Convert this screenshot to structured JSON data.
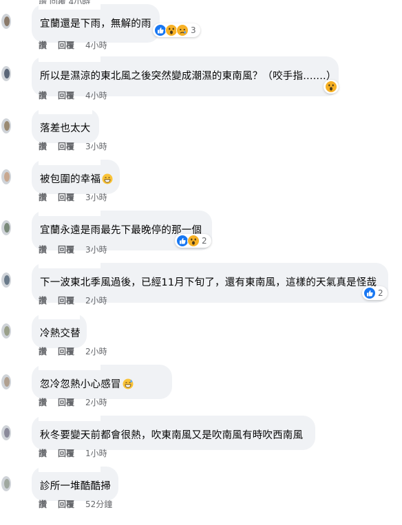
{
  "colors": {
    "bubble": "#f0f2f5",
    "meta": "#65676b",
    "text": "#050505",
    "like_blue": "#1877f2",
    "haha_yellow": "#f7b125"
  },
  "action_labels": {
    "like": "讚",
    "reply": "回覆"
  },
  "top_partial": {
    "text": "讚   回覆   4小時"
  },
  "comments": [
    {
      "text": "宜蘭還是下雨，無解的雨",
      "time": "4小時",
      "reactions": {
        "icons": [
          "like-icon",
          "wow-icon",
          "sad-icon"
        ],
        "count": "3"
      }
    },
    {
      "text": "所以是濕涼的東北風之後突然變成潮濕的東南風？（咬手指.......）",
      "time": "4小時",
      "reactions": {
        "icons": [
          "wow-icon"
        ],
        "count": ""
      }
    },
    {
      "text": "落差也太大",
      "time": "3小時"
    },
    {
      "text": "被包圍的幸福",
      "inline_emoji": "grin-emoji",
      "time": "3小時"
    },
    {
      "text": "宜蘭永遠是雨最先下最晚停的那一個",
      "time": "3小時",
      "reactions": {
        "icons": [
          "like-icon",
          "wow-icon"
        ],
        "count": "2"
      }
    },
    {
      "text": "下一波東北季風過後，已經11月下旬了，還有東南風，這樣的天氣真是怪哉",
      "time": "2小時",
      "reactions": {
        "icons": [
          "like-icon"
        ],
        "count": "2"
      }
    },
    {
      "text": "冷熱交替",
      "time": "2小時"
    },
    {
      "text": "忽冷忽熱小心感冒",
      "inline_emoji": "sweat-smile-emoji",
      "time": "2小時"
    },
    {
      "text": "秋冬要變天前都會很熱，吹東南風又是吹南風有時吹西南風",
      "time": "1小時"
    },
    {
      "text": "診所一堆酷酷掃",
      "time": "52分鐘"
    }
  ]
}
